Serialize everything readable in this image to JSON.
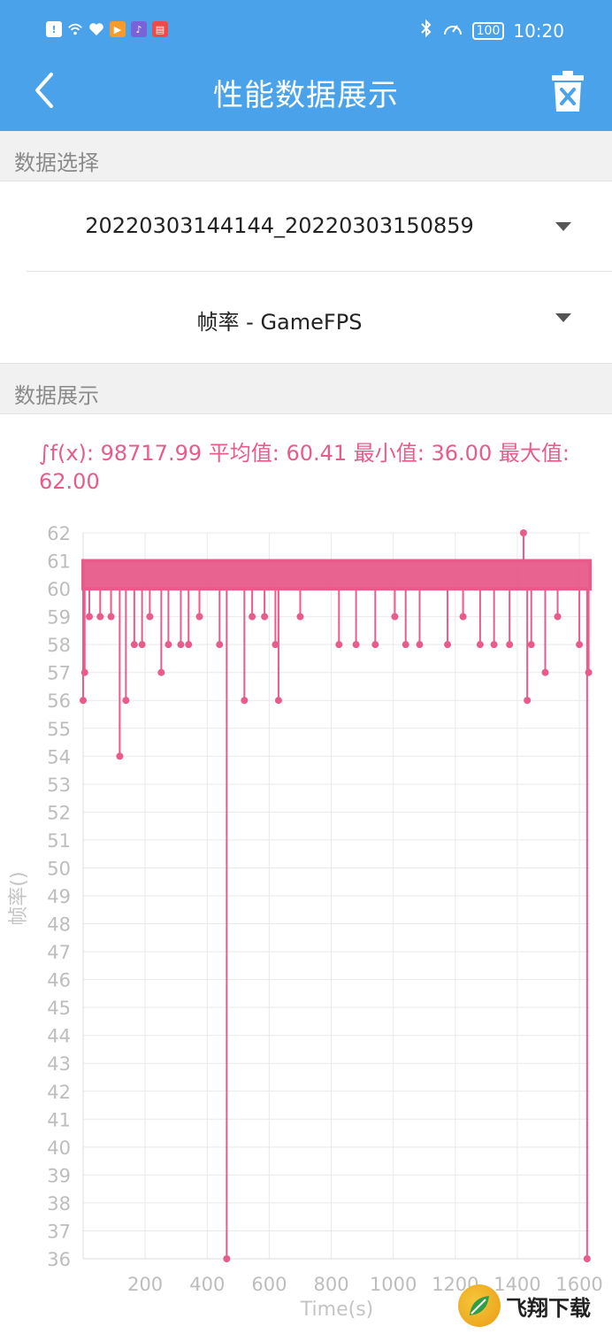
{
  "status_bar": {
    "time": "10:20",
    "battery": "100",
    "left_icons": [
      "alert-icon",
      "wifi-icon",
      "health-icon",
      "video-icon",
      "music-icon",
      "book-icon"
    ],
    "right_icons": [
      "bluetooth-icon",
      "speed-icon"
    ]
  },
  "app_bar": {
    "title": "性能数据展示",
    "accent": "#4aa3ea"
  },
  "sections": {
    "data_select": "数据选择",
    "data_display": "数据展示"
  },
  "selects": {
    "session": "20220303144144_20220303150859",
    "metric": "帧率 - GameFPS"
  },
  "summary": "∫f(x): 98717.99 平均值: 60.41 最小值: 36.00 最大值: 62.00",
  "chart_data": {
    "type": "line",
    "color": "#e85b8a",
    "xlabel": "Time(s)",
    "ylabel": "帧率()",
    "xlim": [
      0,
      1634
    ],
    "ylim": [
      36,
      62
    ],
    "x_ticks": [
      200,
      400,
      600,
      800,
      1000,
      1200,
      1400,
      1600
    ],
    "y_ticks": [
      36,
      37,
      38,
      39,
      40,
      41,
      42,
      43,
      44,
      45,
      46,
      47,
      48,
      49,
      50,
      51,
      52,
      53,
      54,
      55,
      56,
      57,
      58,
      59,
      60,
      61,
      62
    ],
    "baseline_low": 60,
    "baseline_high": 61,
    "dips": [
      [
        0,
        56
      ],
      [
        5,
        57
      ],
      [
        20,
        59
      ],
      [
        55,
        59
      ],
      [
        90,
        59
      ],
      [
        118,
        54
      ],
      [
        138,
        56
      ],
      [
        165,
        58
      ],
      [
        190,
        58
      ],
      [
        215,
        59
      ],
      [
        252,
        57
      ],
      [
        275,
        58
      ],
      [
        315,
        58
      ],
      [
        340,
        58
      ],
      [
        375,
        59
      ],
      [
        440,
        58
      ],
      [
        463,
        36
      ],
      [
        520,
        56
      ],
      [
        545,
        59
      ],
      [
        585,
        59
      ],
      [
        620,
        58
      ],
      [
        630,
        56
      ],
      [
        700,
        59
      ],
      [
        825,
        58
      ],
      [
        880,
        58
      ],
      [
        942,
        58
      ],
      [
        1005,
        59
      ],
      [
        1040,
        58
      ],
      [
        1085,
        58
      ],
      [
        1175,
        58
      ],
      [
        1225,
        59
      ],
      [
        1280,
        58
      ],
      [
        1325,
        58
      ],
      [
        1375,
        58
      ],
      [
        1420,
        62
      ],
      [
        1432,
        56
      ],
      [
        1445,
        58
      ],
      [
        1490,
        57
      ],
      [
        1530,
        59
      ],
      [
        1600,
        58
      ],
      [
        1625,
        36
      ],
      [
        1630,
        57
      ]
    ]
  },
  "watermark": "飞翔下载"
}
